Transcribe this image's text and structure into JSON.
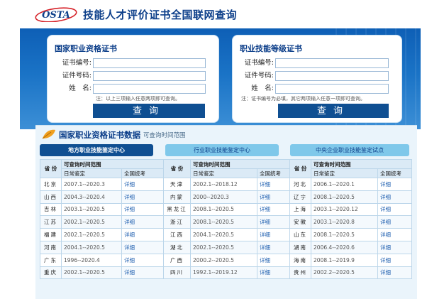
{
  "site": {
    "logo_text": "OSTA",
    "title": "技能人才评价证书全国联网查询"
  },
  "left_card": {
    "title": "国家职业资格证书",
    "fields": [
      {
        "label": "证书编号:",
        "value": ""
      },
      {
        "label": "证件号码:",
        "value": ""
      },
      {
        "label": "姓　名:",
        "value": ""
      }
    ],
    "note": "注：以上三项输入任意两项即可查询。",
    "button": "查询"
  },
  "right_card": {
    "title": "职业技能等级证书",
    "fields": [
      {
        "label": "证书编号:",
        "value": ""
      },
      {
        "label": "证件号码:",
        "value": ""
      },
      {
        "label": "姓　名:",
        "value": ""
      }
    ],
    "note": "注：证书编号为必填，其它两项输入任意一项即可查询。",
    "button": "查询"
  },
  "data_section": {
    "title": "国家职业资格证书数据",
    "subtitle": "可查询时间范围",
    "tabs": [
      "地方职业技能鉴定中心",
      "行业职业技能鉴定中心",
      "中央企业职业技能鉴定试点"
    ],
    "columns": {
      "province": "省 份",
      "range": "可查询时间范围",
      "daily": "日常鉴定",
      "exam": "全国统考"
    },
    "link_label": "详细",
    "rows": [
      [
        {
          "p": "北京",
          "r": "2007.1--2020.3"
        },
        {
          "p": "天津",
          "r": "2002.1--2018.12"
        },
        {
          "p": "河北",
          "r": "2006.1--2020.1"
        }
      ],
      [
        {
          "p": "山西",
          "r": "2004.3--2020.4"
        },
        {
          "p": "内蒙",
          "r": "2000--2020.3"
        },
        {
          "p": "辽宁",
          "r": "2008.1--2020.5"
        }
      ],
      [
        {
          "p": "吉林",
          "r": "2003.1--2020.5"
        },
        {
          "p": "黑龙江",
          "r": "2008.1--2020.5"
        },
        {
          "p": "上海",
          "r": "2003.1--2020.12"
        }
      ],
      [
        {
          "p": "江苏",
          "r": "2002.1--2020.5"
        },
        {
          "p": "浙江",
          "r": "2008.1--2020.5"
        },
        {
          "p": "安徽",
          "r": "2003.1--2020.8"
        }
      ],
      [
        {
          "p": "福建",
          "r": "2002.1--2020.5"
        },
        {
          "p": "江西",
          "r": "2004.1--2020.5"
        },
        {
          "p": "山东",
          "r": "2008.1--2020.5"
        }
      ],
      [
        {
          "p": "河南",
          "r": "2004.1--2020.5"
        },
        {
          "p": "湖北",
          "r": "2002.1--2020.5"
        },
        {
          "p": "湖南",
          "r": "2006.4--2020.6"
        }
      ],
      [
        {
          "p": "广东",
          "r": "1996--2020.4"
        },
        {
          "p": "广西",
          "r": "2000.2--2020.5"
        },
        {
          "p": "海南",
          "r": "2008.1--2019.9"
        }
      ],
      [
        {
          "p": "重庆",
          "r": "2002.1--2020.5"
        },
        {
          "p": "四川",
          "r": "1992.1--2019.12"
        },
        {
          "p": "贵州",
          "r": "2002.2--2020.5"
        }
      ]
    ]
  },
  "colors": {
    "brand": "#0d3f8a",
    "banner": "#1a73c6",
    "button": "#0f4f92",
    "tab_inactive": "#7fc8ea",
    "link": "#2060b0"
  }
}
